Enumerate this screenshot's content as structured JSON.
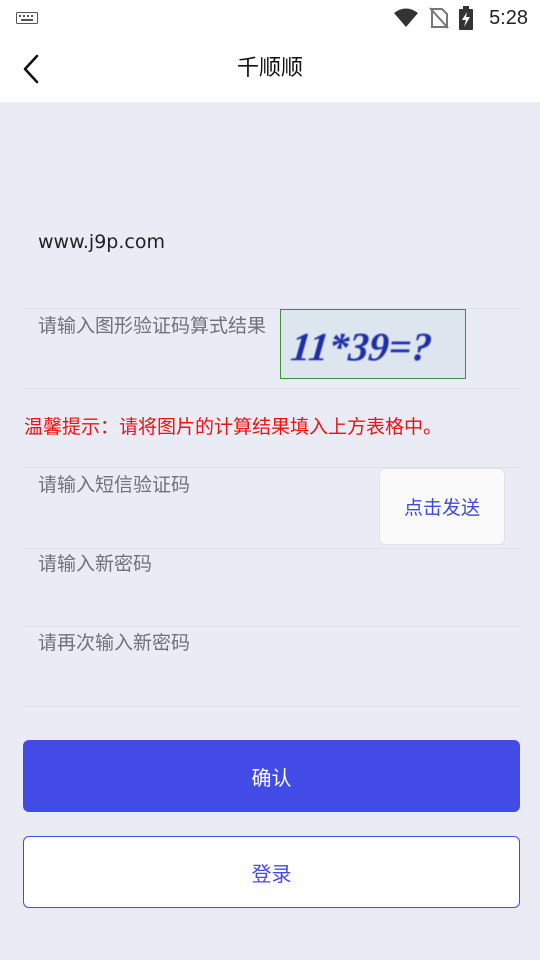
{
  "status_bar": {
    "time": "5:28",
    "icons": [
      "keyboard-icon",
      "wifi-icon",
      "no-sim-icon",
      "battery-charging-icon"
    ]
  },
  "app_bar": {
    "title": "千顺顺",
    "back_icon": "chevron-left-icon"
  },
  "form": {
    "website_value": "www.j9p.com",
    "captcha_placeholder": "请输入图形验证码算式结果",
    "captcha_image_text": "11*39=?",
    "hint": "温馨提示：请将图片的计算结果填入上方表格中。",
    "sms_placeholder": "请输入短信验证码",
    "sms_button": "点击发送",
    "new_password_placeholder": "请输入新密码",
    "confirm_password_placeholder": "请再次输入新密码"
  },
  "buttons": {
    "confirm": "确认",
    "login": "登录"
  },
  "colors": {
    "primary": "#434be6",
    "hint": "#ee1111",
    "background": "#e9ebf5",
    "captcha_text": "#1e2fa8",
    "captcha_bg": "#e8edf4"
  }
}
